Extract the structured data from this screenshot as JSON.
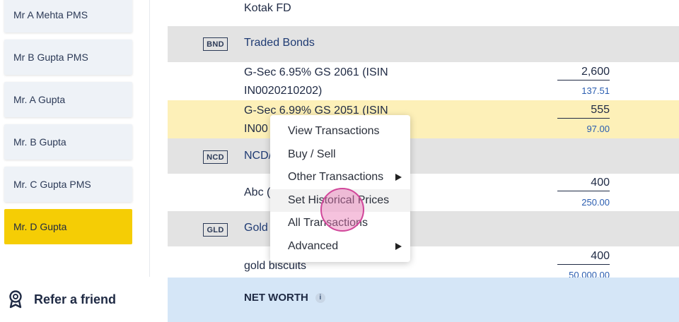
{
  "sidebar": {
    "clients": [
      {
        "label": "Mr A Mehta PMS"
      },
      {
        "label": "Mr B Gupta PMS"
      },
      {
        "label": "Mr. A Gupta"
      },
      {
        "label": "Mr. B Gupta"
      },
      {
        "label": "Mr. C Gupta PMS"
      },
      {
        "label": "Mr. D Gupta"
      }
    ],
    "refer_label": "Refer a friend",
    "active_color": "#f5cd05"
  },
  "holdings": {
    "kotak_fd": {
      "name": "Kotak FD"
    },
    "bonds": {
      "tag": "BND",
      "label": "Traded Bonds",
      "items": [
        {
          "name_line1": "G-Sec 6.95% GS 2061 (ISIN",
          "name_line2": "IN0020210202)",
          "value": "2,600",
          "sub": "137.51"
        },
        {
          "name_line1": "G-Sec 6.99% GS 2051 (ISIN",
          "name_line2": "IN00",
          "value": "555",
          "sub": "97.00"
        }
      ]
    },
    "ncd": {
      "tag": "NCD",
      "label": "NCD/",
      "items": [
        {
          "name": "Abc (",
          "value": "400",
          "sub": "250.00"
        }
      ]
    },
    "gold": {
      "tag": "GLD",
      "label": "Gold",
      "items": [
        {
          "name": "gold biscuits",
          "value": "400",
          "sub": "50,000.00"
        }
      ]
    },
    "net_worth": {
      "label": "NET WORTH",
      "info": "i"
    }
  },
  "context_menu": {
    "items": [
      {
        "label": "View Transactions"
      },
      {
        "label": "Buy / Sell"
      },
      {
        "label": "Other Transactions"
      },
      {
        "label": "Set Historical Prices"
      },
      {
        "label": "All Transactions"
      },
      {
        "label": "Advanced"
      }
    ]
  },
  "colors": {
    "highlight_row": "#fdf0b8",
    "net_worth_row": "#d5e6f7",
    "category_row": "#e3e3e3",
    "click_indicator": "#d1479a"
  }
}
